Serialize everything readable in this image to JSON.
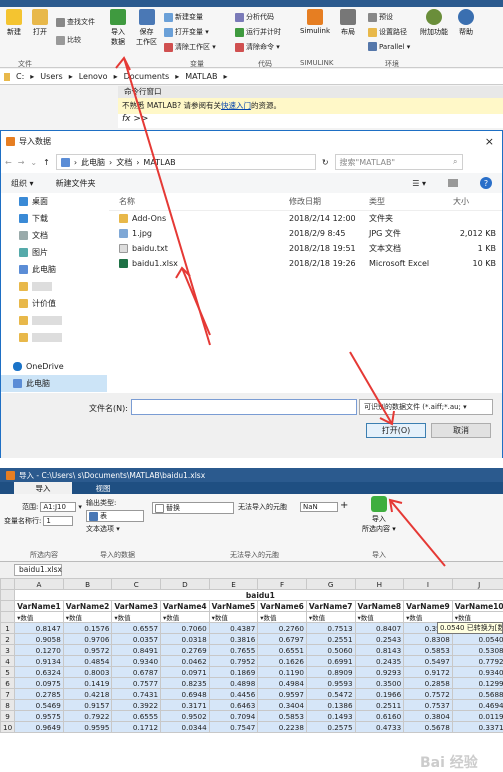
{
  "matlab": {
    "title_fragment": "新建",
    "ribbon": {
      "buttons": [
        "新建",
        "打开",
        "比较",
        "导入\n数据",
        "保存\n工作区"
      ],
      "small_items": [
        "查找文件",
        "新建变量",
        "打开变量 ▾",
        "清除工作区 ▾",
        "分析代码",
        "运行并计时",
        "清除命令 ▾",
        "Simulink",
        "布局",
        "预设",
        "设置路径",
        "Parallel ▾",
        "附加功能",
        "帮助"
      ],
      "groups": [
        "文件",
        "变量",
        "代码",
        "SIMULINK",
        "环境"
      ]
    },
    "path": [
      "C:",
      "Users",
      "Lenovo",
      "Documents",
      "MATLAB"
    ],
    "cmd_title": "命令行窗口",
    "cmd_note_prefix": "不熟悉 MATLAB? 请参阅有关",
    "cmd_note_link": "快速入门",
    "cmd_note_suffix": "的资源。",
    "fx": "fx >>"
  },
  "dialog": {
    "title": "导入数据",
    "close": "×",
    "crumbs": [
      "此电脑",
      "文档",
      "MATLAB"
    ],
    "search_placeholder": "搜索\"MATLAB\"",
    "organize": "组织 ▾",
    "new_folder": "新建文件夹",
    "nav": [
      "桌面",
      "下载",
      "文档",
      "图片",
      "此电脑",
      "",
      "计价值",
      "",
      "",
      "",
      "OneDrive",
      "此电脑",
      "网络"
    ],
    "columns": [
      "名称",
      "修改日期",
      "类型",
      "大小"
    ],
    "files": [
      {
        "name": "Add-Ons",
        "date": "2018/2/14 12:00",
        "type": "文件夹",
        "size": ""
      },
      {
        "name": "1.jpg",
        "date": "2018/2/9 8:45",
        "type": "JPG 文件",
        "size": "2,012 KB"
      },
      {
        "name": "baidu.txt",
        "date": "2018/2/18 19:51",
        "type": "文本文档",
        "size": "1 KB"
      },
      {
        "name": "baidu1.xlsx",
        "date": "2018/2/18 19:26",
        "type": "Microsoft Excel",
        "size": "10 KB"
      }
    ],
    "filename_label": "文件名(N):",
    "filter": "可识别的数据文件 (*.aiff;*.au; ▾",
    "open": "打开(O)",
    "cancel": "取消"
  },
  "importer": {
    "title": "导入 - C:\\Users\\      s\\Documents\\MATLAB\\baidu1.xlsx",
    "tabs": [
      "导入",
      "视图"
    ],
    "range_label": "范围:",
    "range_value": "A1:J10",
    "varrow_label": "变量名称行:",
    "varrow_value": "1",
    "output_label": "输出类型:",
    "output_value": "表",
    "text_option": "文本选项 ▾",
    "replace": "替换",
    "unimportable": "无法导入的元胞",
    "nan": "NaN",
    "import_btn": "导入\n所选内容 ▾",
    "groups": [
      "所选内容",
      "导入的数据",
      "无法导入的元胞",
      "导入"
    ],
    "sheet": "baidu1.xlsx",
    "col_letters": [
      "A",
      "B",
      "C",
      "D",
      "E",
      "F",
      "G",
      "H",
      "I",
      "J"
    ],
    "sheet_title": "baidu1",
    "varnames": [
      "VarName1",
      "VarName2",
      "VarName3",
      "VarName4",
      "VarName5",
      "VarName6",
      "VarName7",
      "VarName8",
      "VarName9",
      "VarName10"
    ],
    "type_label": "▾数值",
    "rows": [
      [
        "0.8147",
        "0.1576",
        "0.6557",
        "0.7060",
        "0.4387",
        "0.2760",
        "0.7513",
        "0.8407",
        "0.3517",
        "0.0540"
      ],
      [
        "0.9058",
        "0.9706",
        "0.0357",
        "0.0318",
        "0.3816",
        "0.6797",
        "0.2551",
        "0.2543",
        "0.8308",
        "0.0540"
      ],
      [
        "0.1270",
        "0.9572",
        "0.8491",
        "0.2769",
        "0.7655",
        "0.6551",
        "0.5060",
        "0.8143",
        "0.5853",
        "0.5308"
      ],
      [
        "0.9134",
        "0.4854",
        "0.9340",
        "0.0462",
        "0.7952",
        "0.1626",
        "0.6991",
        "0.2435",
        "0.5497",
        "0.7792"
      ],
      [
        "0.6324",
        "0.8003",
        "0.6787",
        "0.0971",
        "0.1869",
        "0.1190",
        "0.8909",
        "0.9293",
        "0.9172",
        "0.9340"
      ],
      [
        "0.0975",
        "0.1419",
        "0.7577",
        "0.8235",
        "0.4898",
        "0.4984",
        "0.9593",
        "0.3500",
        "0.2858",
        "0.1299"
      ],
      [
        "0.2785",
        "0.4218",
        "0.7431",
        "0.6948",
        "0.4456",
        "0.9597",
        "0.5472",
        "0.1966",
        "0.7572",
        "0.5688"
      ],
      [
        "0.5469",
        "0.9157",
        "0.3922",
        "0.3171",
        "0.6463",
        "0.3404",
        "0.1386",
        "0.2511",
        "0.7537",
        "0.4694"
      ],
      [
        "0.9575",
        "0.7922",
        "0.6555",
        "0.9502",
        "0.7094",
        "0.5853",
        "0.1493",
        "0.6160",
        "0.3804",
        "0.0119"
      ],
      [
        "0.9649",
        "0.9595",
        "0.1712",
        "0.0344",
        "0.7547",
        "0.2238",
        "0.2575",
        "0.4733",
        "0.5678",
        "0.3371"
      ]
    ],
    "tooltip": "0.0540 已转换为[数"
  },
  "watermark": "Bai 经验"
}
